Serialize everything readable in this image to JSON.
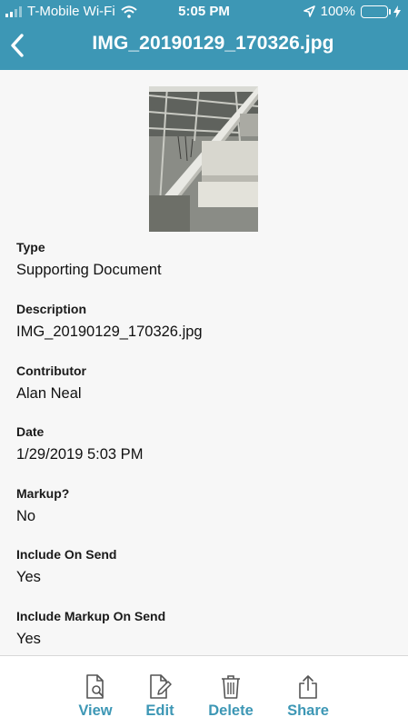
{
  "status_bar": {
    "carrier": "T-Mobile Wi-Fi",
    "time": "5:05 PM",
    "battery": "100%"
  },
  "header": {
    "title": "IMG_20190129_170326.jpg"
  },
  "fields": [
    {
      "label": "Type",
      "value": "Supporting Document"
    },
    {
      "label": "Description",
      "value": "IMG_20190129_170326.jpg"
    },
    {
      "label": "Contributor",
      "value": "Alan Neal"
    },
    {
      "label": "Date",
      "value": "1/29/2019 5:03 PM"
    },
    {
      "label": "Markup?",
      "value": "No"
    },
    {
      "label": "Include On Send",
      "value": "Yes"
    },
    {
      "label": "Include Markup On Send",
      "value": "Yes"
    }
  ],
  "tabbar": {
    "items": [
      {
        "label": "View",
        "icon": "view-document-icon"
      },
      {
        "label": "Edit",
        "icon": "edit-document-icon"
      },
      {
        "label": "Delete",
        "icon": "trash-icon"
      },
      {
        "label": "Share",
        "icon": "share-icon"
      }
    ]
  },
  "colors": {
    "header_bg": "#3d97b5",
    "accent": "#3d97b5",
    "battery": "#4cd964"
  }
}
